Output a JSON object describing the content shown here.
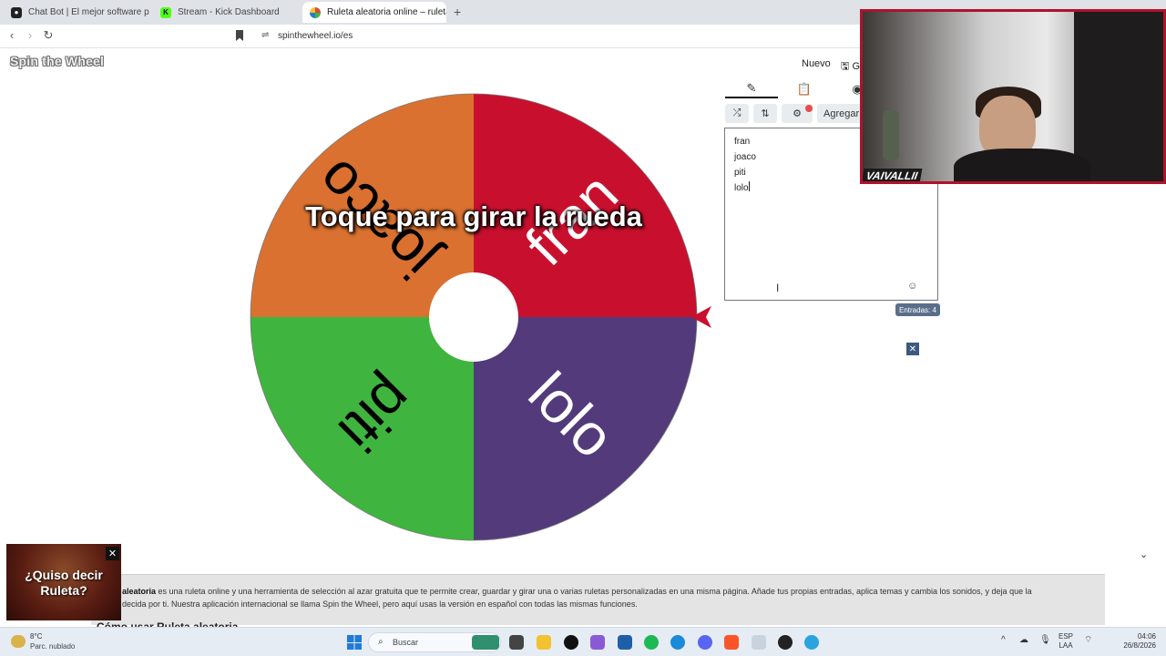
{
  "browser": {
    "tabs": [
      {
        "title": "Chat Bot | El mejor software para pot",
        "color": "#222222"
      },
      {
        "title": "Stream - Kick Dashboard",
        "color": "#53fc18"
      },
      {
        "title": "Ruleta aleatoria online – ruleta d",
        "color": "#e0463a"
      }
    ],
    "url": "spinthewheel.io/es"
  },
  "header": {
    "logo": "Spin the Wheel",
    "nuevo": "Nuevo",
    "guardar": "Gu"
  },
  "wheel": {
    "cta": "Toque para girar la rueda",
    "segments": [
      {
        "label": "fran",
        "color": "#c8102e"
      },
      {
        "label": "lolo",
        "color": "#533a7b"
      },
      {
        "label": "piti",
        "color": "#3fb53f"
      },
      {
        "label": "joaco",
        "color": "#da7130"
      }
    ],
    "pointer_color": "#c8102e"
  },
  "panel": {
    "agregar": "Agregar",
    "entries": [
      "fran",
      "joaco",
      "piti",
      "lolo"
    ],
    "entries_badge": "Entradas: 4"
  },
  "webcam": {
    "tag": "VAIVALLII"
  },
  "article": {
    "lead": "aleatoria",
    "body": " es una ruleta online y una herramienta de selección al azar gratuita que te permite crear, guardar y girar una o varias ruletas personalizadas en una misma página. Añade tus propias entradas, aplica temas y cambia los sonidos, y deja que la",
    "body2": "decida por ti. Nuestra aplicación internacional se llama Spin the Wheel, pero aquí usas la versión en español con todas las mismas funciones.",
    "heading": "Cómo usar Ruleta aleatoria"
  },
  "promo": {
    "line1": "¿Quiso decir",
    "line2": "Ruleta?"
  },
  "taskbar": {
    "temp": "8°C",
    "weather": "Parc. nublado",
    "search": "Buscar",
    "lang1": "ESP",
    "lang2": "LAA",
    "time": "04:06",
    "date": "26/8/2026"
  }
}
